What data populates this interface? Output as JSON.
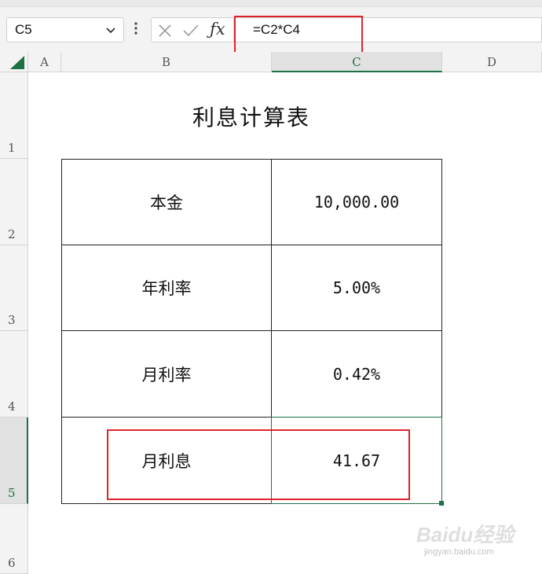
{
  "formula_bar": {
    "name_box": "C5",
    "formula": "=C2*C4"
  },
  "columns": [
    "A",
    "B",
    "C",
    "D"
  ],
  "rows": [
    "1",
    "2",
    "3",
    "4",
    "5",
    "6"
  ],
  "selected_cell": "C5",
  "sheet": {
    "title": "利息计算表",
    "table": [
      {
        "label": "本金",
        "value": "10,000.00"
      },
      {
        "label": "年利率",
        "value": "5.00%"
      },
      {
        "label": "月利率",
        "value": "0.42%"
      },
      {
        "label": "月利息",
        "value": "41.67"
      }
    ]
  },
  "colors": {
    "highlight": "#e0222e",
    "selection": "#1e7145"
  },
  "icons": [
    "chevron-down-icon",
    "more-vertical-icon",
    "cancel-icon",
    "confirm-icon",
    "fx-icon"
  ],
  "watermark": {
    "brand": "Baidu经验",
    "url": "jingyan.baidu.com"
  }
}
